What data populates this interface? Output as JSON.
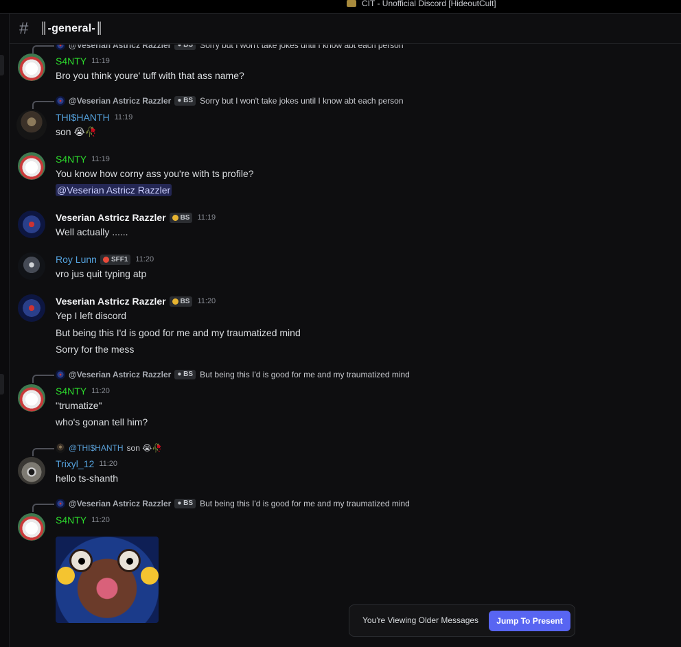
{
  "window": {
    "title": "CIT - Unofficial Discord [HideoutCult]"
  },
  "channel": {
    "hash": "#",
    "name": "║-general-║"
  },
  "messages": [
    {
      "reply": {
        "author": "@Veserian Astricz Razzler",
        "tag": "BS",
        "text": "Sorry but I won't take jokes until I know abt each person"
      },
      "author": "S4NTY",
      "time": "11:19",
      "lines": [
        "Bro you think youre' tuff with that ass name?"
      ]
    },
    {
      "reply": {
        "author": "@Veserian Astricz Razzler",
        "tag": "BS",
        "text": "Sorry but I won't take jokes until I know abt each person"
      },
      "author": "THI$HANTH",
      "time": "11:19",
      "lines": [
        "son 😭🥀"
      ]
    },
    {
      "author": "S4NTY",
      "time": "11:19",
      "lines": [
        "You know how corny ass you're with ts profile?",
        "@Veserian Astricz Razzler"
      ]
    },
    {
      "author": "Veserian Astricz Razzler",
      "tag": "BS",
      "time": "11:19",
      "lines": [
        "Well actually ......"
      ]
    },
    {
      "author": "Roy Lunn",
      "tag": "SFF1",
      "time": "11:20",
      "lines": [
        "vro jus quit typing atp"
      ]
    },
    {
      "author": "Veserian Astricz Razzler",
      "tag": "BS",
      "time": "11:20",
      "lines": [
        "Yep I left discord",
        "But being this I'd is good for me and my traumatized mind",
        "Sorry for the mess"
      ]
    },
    {
      "reply": {
        "author": "@Veserian Astricz Razzler",
        "tag": "BS",
        "text": "But being this I'd is good for me and my traumatized mind"
      },
      "author": "S4NTY",
      "time": "11:20",
      "lines": [
        "\"trumatize\"",
        "who's gonan tell him?"
      ]
    },
    {
      "reply": {
        "author": "@THI$HANTH",
        "text": "son 😭🥀"
      },
      "author": "Trixyl_12",
      "time": "11:20",
      "lines": [
        "hello ts-shanth"
      ]
    },
    {
      "reply": {
        "author": "@Veserian Astricz Razzler",
        "tag": "BS",
        "text": "But being this I'd is good for me and my traumatized mind"
      },
      "author": "S4NTY",
      "time": "11:20",
      "attachment": "image"
    }
  ],
  "banner": {
    "text": "You're Viewing Older Messages",
    "button": "Jump To Present"
  },
  "colors": {
    "accent": "#5865f2",
    "s4nty": "#2ddc2d",
    "blue_name": "#55a4e0",
    "background": "#0e0e10"
  }
}
